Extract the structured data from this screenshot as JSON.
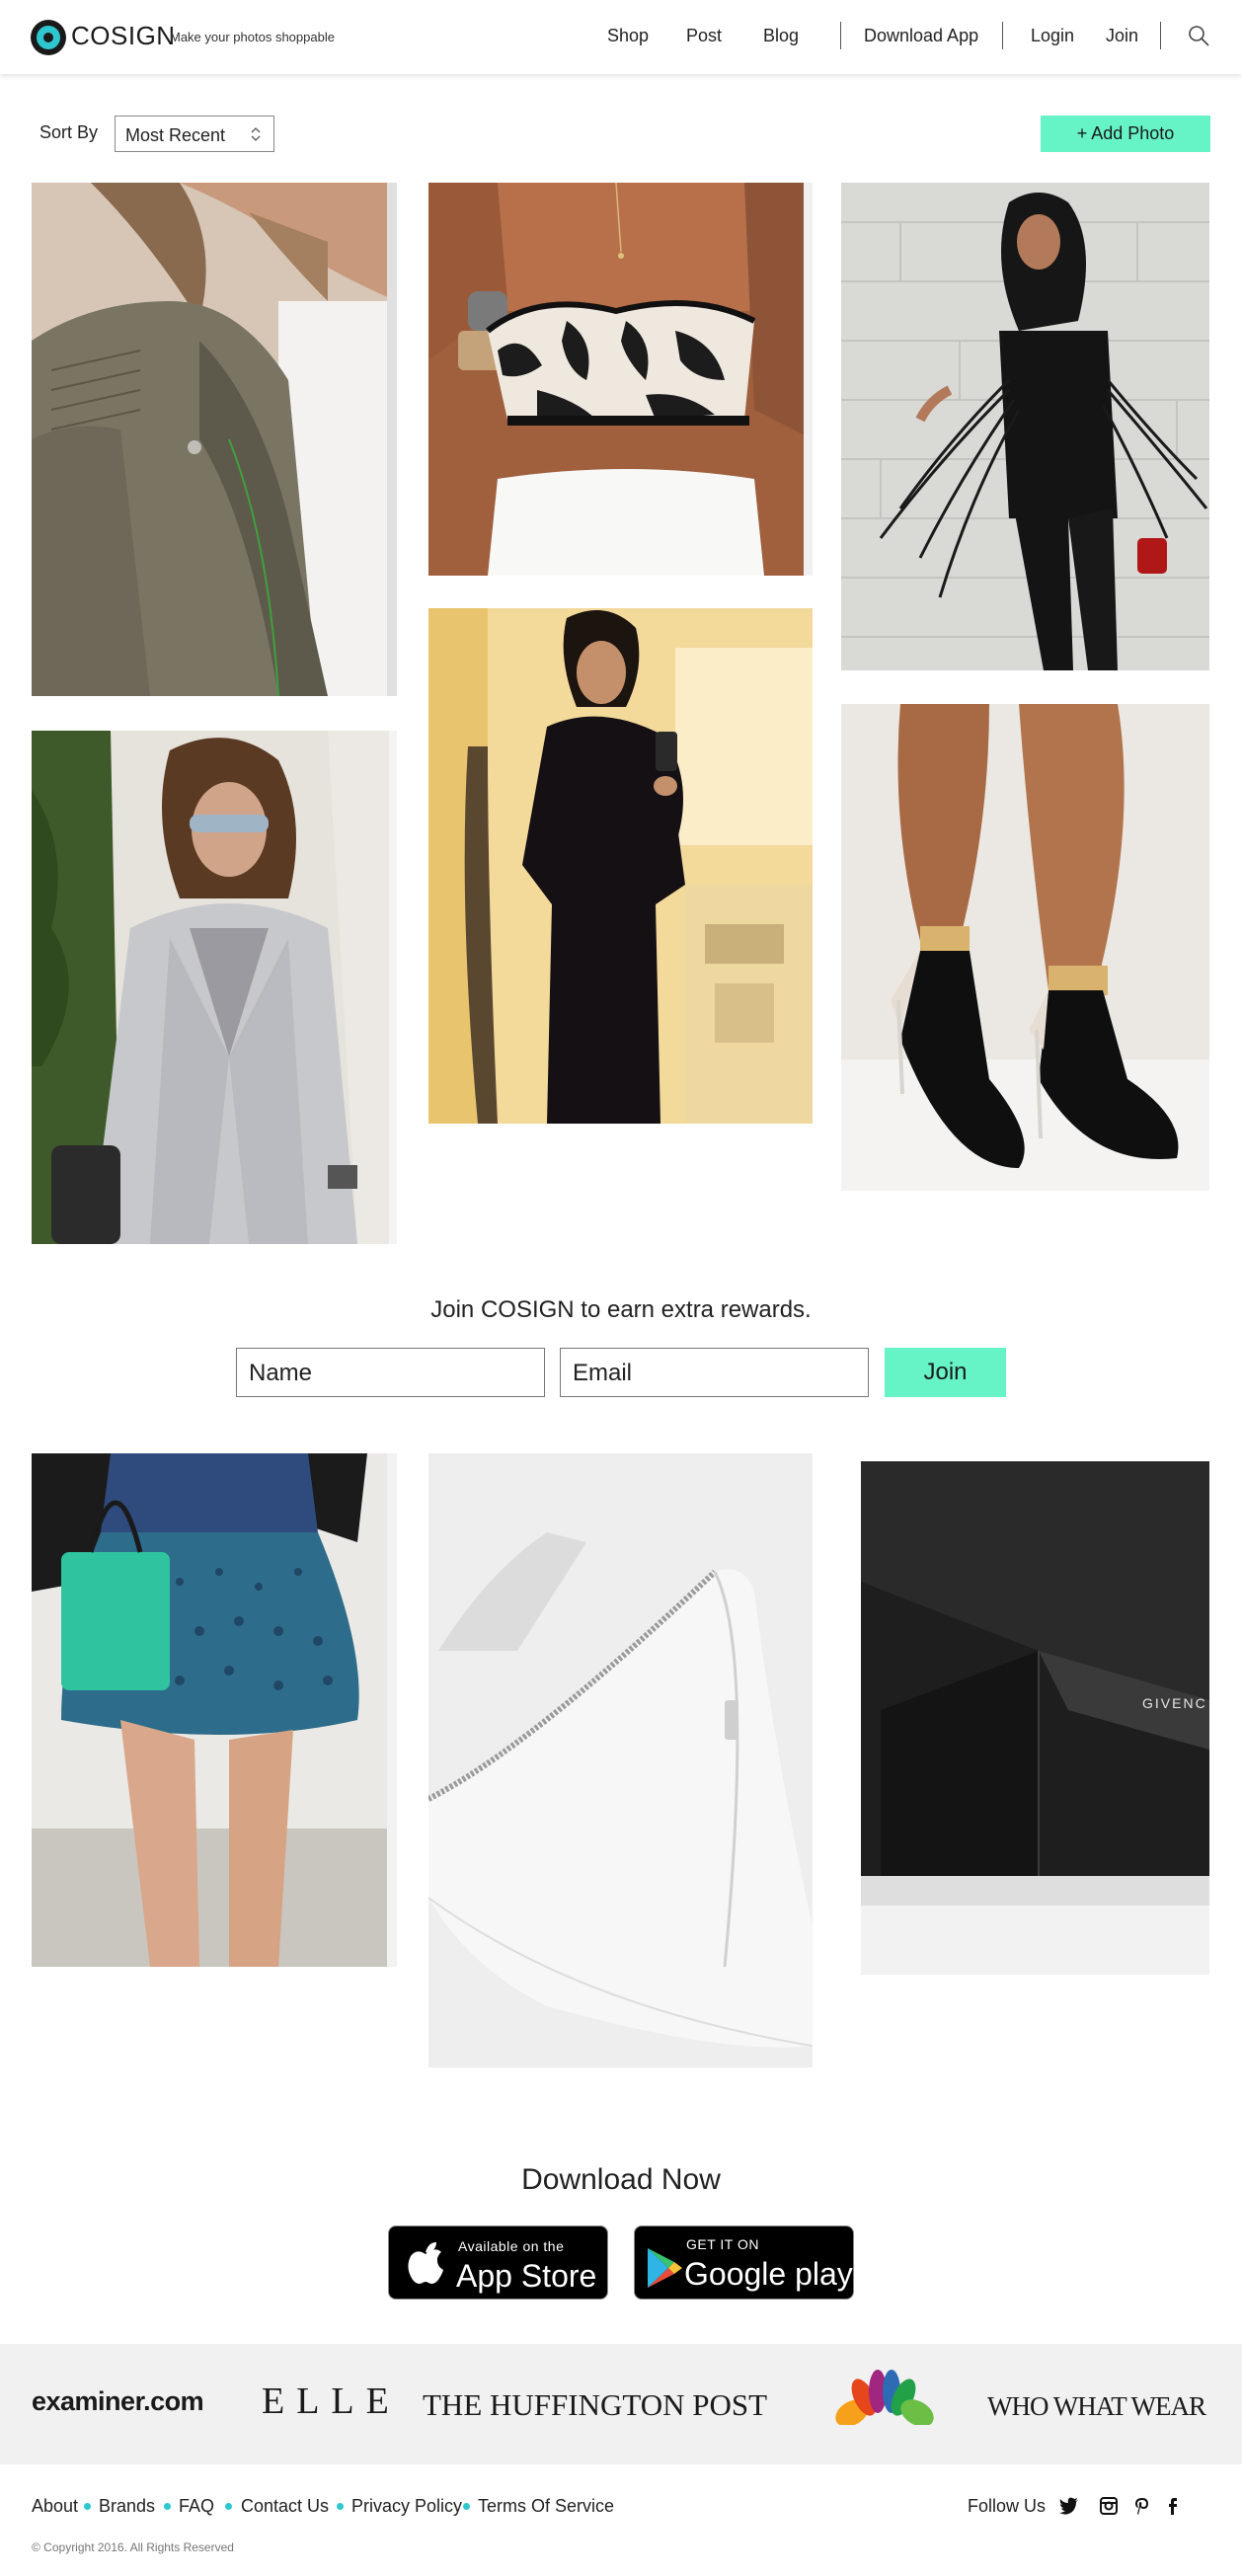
{
  "header": {
    "brand": "COSIGN",
    "tagline": "Make your photos shoppable",
    "nav": [
      "Shop",
      "Post",
      "Blog"
    ],
    "download_app": "Download App",
    "login": "Login",
    "join": "Join"
  },
  "toolbar": {
    "sort_label": "Sort By",
    "sort_value": "Most Recent",
    "add_photo": "+ Add Photo"
  },
  "signup": {
    "text": "Join COSIGN to earn extra rewards.",
    "name_placeholder": "Name",
    "email_placeholder": "Email",
    "join_button": "Join"
  },
  "download": {
    "title": "Download Now",
    "app_store_small": "Available on the",
    "app_store_big": "App Store",
    "google_small": "GET IT ON",
    "google_big": "Google play"
  },
  "press": {
    "examiner": "examiner.com",
    "elle": "ELLE",
    "huffington": "THE HUFFINGTON POST",
    "whowhatwear": "WHO WHAT WEAR"
  },
  "footer": {
    "links": [
      "About",
      "Brands",
      "FAQ",
      "Contact Us",
      "Privacy Policy",
      "Terms Of Service"
    ],
    "follow_label": "Follow Us",
    "social_icons": [
      "twitter-icon",
      "instagram-icon",
      "pinterest-icon",
      "facebook-icon"
    ],
    "copyright": "© Copyright 2016. All Rights Reserved"
  },
  "colors": {
    "accent": "#66f3c6",
    "brand_teal": "#2ec7cf",
    "press_bg": "#f1f1f1"
  }
}
